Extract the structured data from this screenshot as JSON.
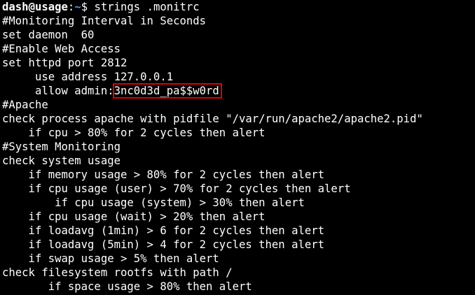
{
  "prompt": {
    "user": "dash",
    "at": "@",
    "host": "usage",
    "sep": ":",
    "path": "~",
    "symbol": "$ ",
    "command": "strings .monitrc"
  },
  "lines": {
    "l1": "#Monitoring Interval in Seconds",
    "l2": "set daemon  60",
    "l3": "#Enable Web Access",
    "l4": "set httpd port 2812",
    "l5": "     use address 127.0.0.1",
    "l6_prefix": "     allow admin:",
    "l6_password": "3nc0d3d_pa$$w0rd",
    "l7": "#Apache",
    "l8": "check process apache with pidfile \"/var/run/apache2/apache2.pid\"",
    "l9": "    if cpu > 80% for 2 cycles then alert",
    "l10": "#System Monitoring",
    "l11": "check system usage",
    "l12": "    if memory usage > 80% for 2 cycles then alert",
    "l13": "    if cpu usage (user) > 70% for 2 cycles then alert",
    "l14": "        if cpu usage (system) > 30% then alert",
    "l15": "    if cpu usage (wait) > 20% then alert",
    "l16": "    if loadavg (1min) > 6 for 2 cycles then alert",
    "l17": "    if loadavg (5min) > 4 for 2 cycles then alert",
    "l18": "    if swap usage > 5% then alert",
    "l19": "check filesystem rootfs with path /",
    "l20": "       if space usage > 80% then alert"
  },
  "colors": {
    "background": "#000000",
    "text": "#ffffff",
    "path": "#5c8cff",
    "highlight_box": "#e00000"
  }
}
